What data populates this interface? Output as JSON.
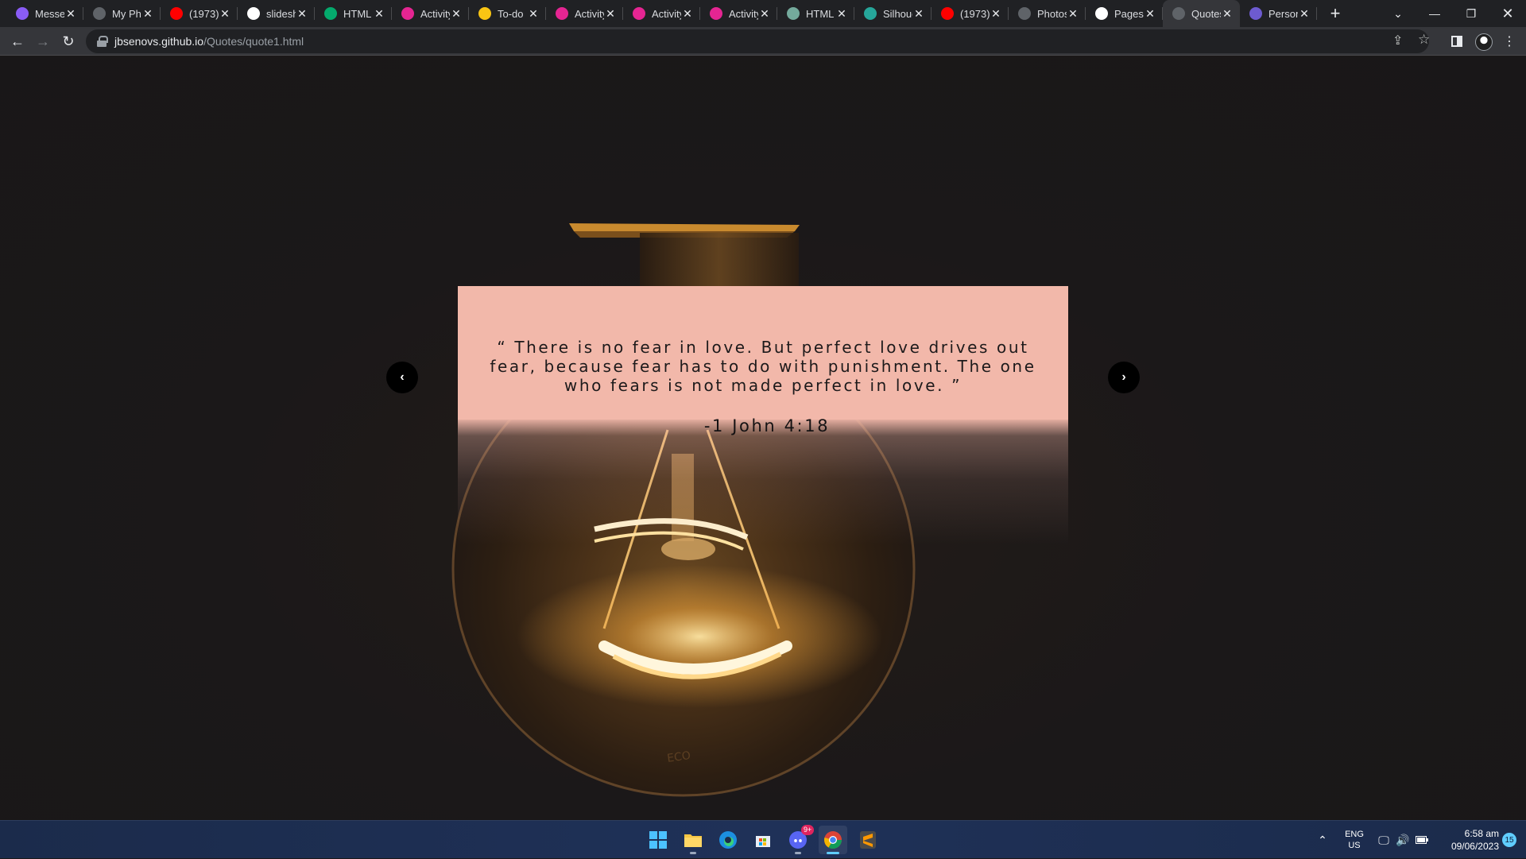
{
  "browser": {
    "tabs": [
      {
        "title": "Messenger",
        "favicon": "messenger-icon",
        "color": "#8a5cf6"
      },
      {
        "title": "My Photos",
        "favicon": "globe-icon",
        "color": "#5f6368"
      },
      {
        "title": "(1973)",
        "favicon": "youtube-icon",
        "color": "#ff0000"
      },
      {
        "title": "slideshow",
        "favicon": "google-icon",
        "color": "#ffffff"
      },
      {
        "title": "HTML",
        "favicon": "w3schools-icon",
        "color": "#04aa6d"
      },
      {
        "title": "Activity",
        "favicon": "classroom-icon",
        "color": "#e52592"
      },
      {
        "title": "To-do",
        "favicon": "classroom-icon",
        "color": "#f9c513"
      },
      {
        "title": "Activity",
        "favicon": "classroom-icon",
        "color": "#e52592"
      },
      {
        "title": "Activity",
        "favicon": "classroom-icon",
        "color": "#e52592"
      },
      {
        "title": "Activity",
        "favicon": "classroom-icon",
        "color": "#e52592"
      },
      {
        "title": "HTML",
        "favicon": "openai-icon",
        "color": "#74aa9c"
      },
      {
        "title": "Silhouette",
        "favicon": "doc-icon",
        "color": "#26a69a"
      },
      {
        "title": "(1973)",
        "favicon": "youtube-icon",
        "color": "#ff0000"
      },
      {
        "title": "Photos",
        "favicon": "globe-icon",
        "color": "#5f6368"
      },
      {
        "title": "Pages",
        "favicon": "github-icon",
        "color": "#ffffff"
      },
      {
        "title": "Quotes",
        "favicon": "globe-icon",
        "color": "#5f6368",
        "active": true
      },
      {
        "title": "Personal",
        "favicon": "portfolio-icon",
        "color": "#6d5bd0"
      }
    ],
    "url_host": "jbsenovs.github.io",
    "url_path": "/Quotes/quote1.html"
  },
  "quote": {
    "text": "“ There is no fear in love. But perfect love drives out fear, because fear has to do with punishment. The one who fears is not made perfect in love. ”",
    "author": "-1 John 4:18",
    "prev_label": "‹",
    "next_label": "›"
  },
  "taskbar": {
    "apps": [
      "start",
      "file-explorer",
      "edge",
      "microsoft-store",
      "discord",
      "chrome",
      "sublime-text"
    ],
    "discord_badge": "9+",
    "lang_top": "ENG",
    "lang_bottom": "US",
    "time": "6:58 am",
    "date": "09/06/2023",
    "notification_count": "15"
  }
}
